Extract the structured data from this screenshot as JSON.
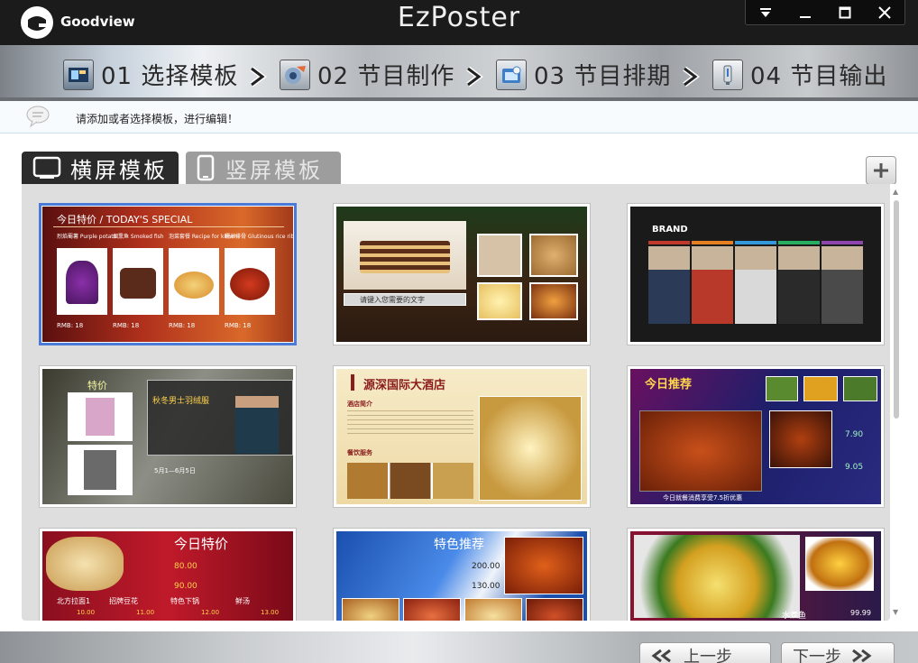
{
  "app": {
    "brand": "Goodview",
    "title": "EzPoster",
    "window_controls": [
      "dropdown-icon",
      "minimize-icon",
      "maximize-icon",
      "close-icon"
    ]
  },
  "steps": [
    {
      "label": "01 选择模板",
      "icon": "template-icon"
    },
    {
      "label": "02 节目制作",
      "icon": "program-icon"
    },
    {
      "label": "03 节目排期",
      "icon": "schedule-icon"
    },
    {
      "label": "04 节目输出",
      "icon": "export-icon"
    }
  ],
  "hint": "请添加或者选择模板，进行编辑！",
  "tabs": {
    "landscape": "横屏模板",
    "portrait": "竖屏模板"
  },
  "templates": [
    {
      "title": "今日特价 / TODAY'S SPECIAL",
      "items": [
        "烈焰蜀薯 Purple potato",
        "烟熏鱼 Smoked fish",
        "泡菜套餐 Recipe for kimchi",
        "糯米排骨 Glutinous rice ribs"
      ],
      "price": "RMB: 18"
    },
    {
      "caption": "请键入您需要的文字"
    },
    {
      "title": "BRAND"
    },
    {
      "title": "特价",
      "ad_title": "秋冬男士羽绒服",
      "ad_price": "5月1—6月5日"
    },
    {
      "title": "源深国际大酒店",
      "section1": "酒店简介",
      "section2": "餐饮服务"
    },
    {
      "title": "今日推荐",
      "prices": [
        "7.90",
        "9.05"
      ],
      "caption": "今日就餐消费享受7.5折优惠"
    },
    {
      "title": "今日特价",
      "prices": [
        "80.00",
        "90.00"
      ],
      "names": [
        "北方拉面1",
        "招牌豆花",
        "特色下锅",
        "鲜汤"
      ],
      "values": [
        "10.00",
        "11.00",
        "12.00",
        "13.00"
      ]
    },
    {
      "title": "特色推荐",
      "prices": [
        "200.00",
        "130.00"
      ]
    },
    {
      "caption": "水煮鱼",
      "price": "99.99"
    }
  ],
  "nav": {
    "prev": "上一步",
    "next": "下一步"
  },
  "colors": {
    "selected_border": "#4a7bd8",
    "titlebar": "#1b1b1b"
  }
}
